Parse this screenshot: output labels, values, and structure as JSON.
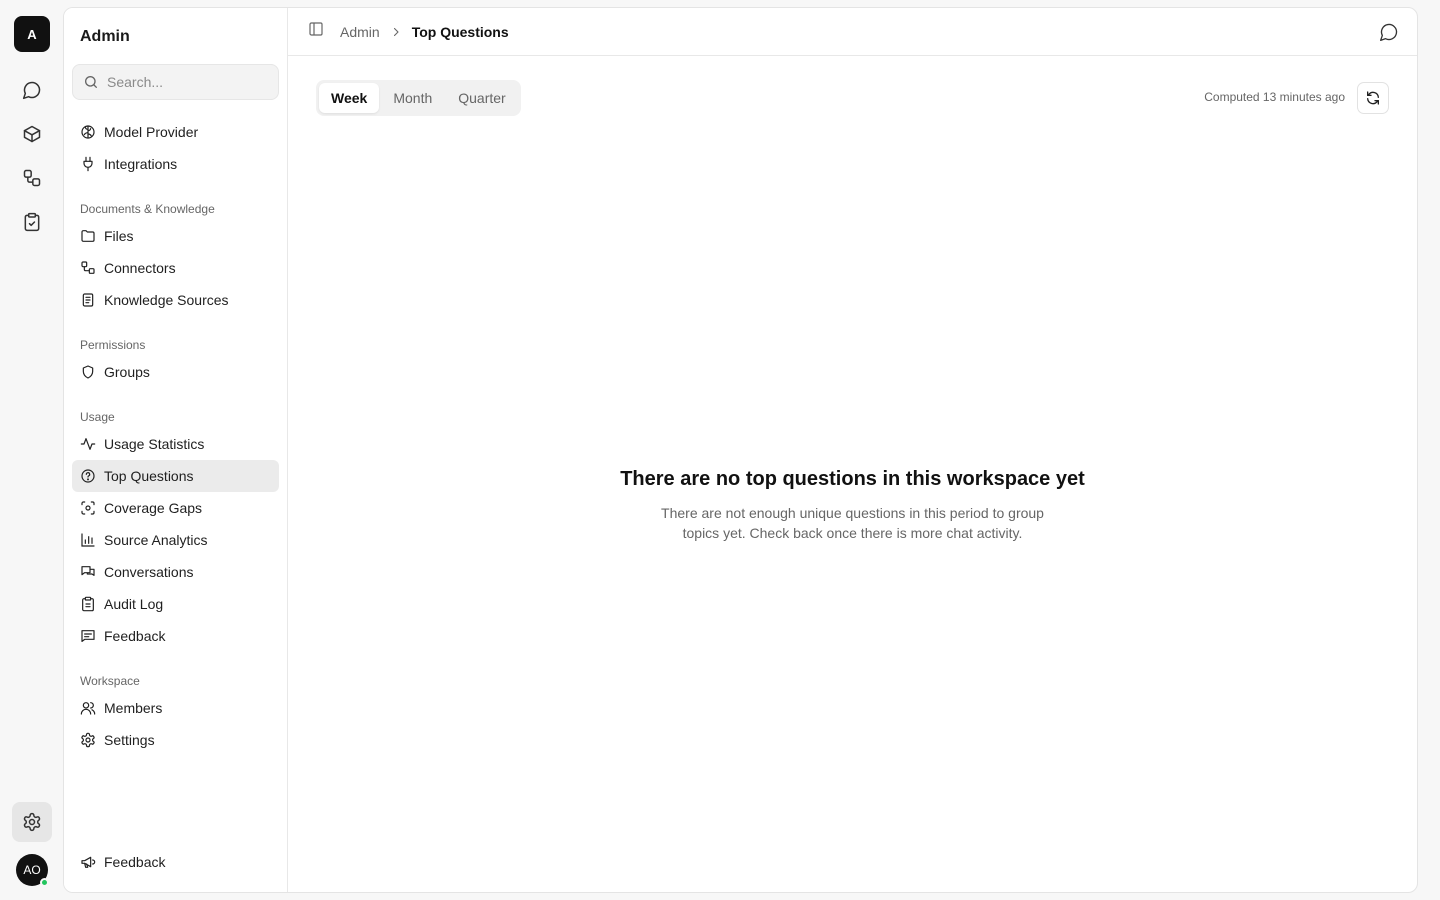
{
  "rail": {
    "workspace_initial": "A",
    "user_initials": "AO"
  },
  "sidebar": {
    "title": "Admin",
    "search_placeholder": "Search...",
    "top_items": [
      {
        "label": "Model Provider",
        "icon": "brain-icon"
      },
      {
        "label": "Integrations",
        "icon": "plug-icon"
      }
    ],
    "sections": [
      {
        "label": "Documents & Knowledge",
        "items": [
          "Files",
          "Connectors",
          "Knowledge Sources"
        ]
      },
      {
        "label": "Permissions",
        "items": [
          "Groups"
        ]
      },
      {
        "label": "Usage",
        "items": [
          "Usage Statistics",
          "Top Questions",
          "Coverage Gaps",
          "Source Analytics",
          "Conversations",
          "Audit Log",
          "Feedback"
        ]
      },
      {
        "label": "Workspace",
        "items": [
          "Members",
          "Settings"
        ]
      }
    ],
    "footer_item": "Feedback",
    "active_item": "Top Questions"
  },
  "breadcrumb": {
    "parent": "Admin",
    "current": "Top Questions"
  },
  "toolbar": {
    "periods": [
      "Week",
      "Month",
      "Quarter"
    ],
    "active_period": "Week",
    "computed_text": "Computed 13 minutes ago"
  },
  "empty_state": {
    "title": "There are no top questions in this workspace yet",
    "description": "There are not enough unique questions in this period to group topics yet. Check back once there is more chat activity."
  }
}
